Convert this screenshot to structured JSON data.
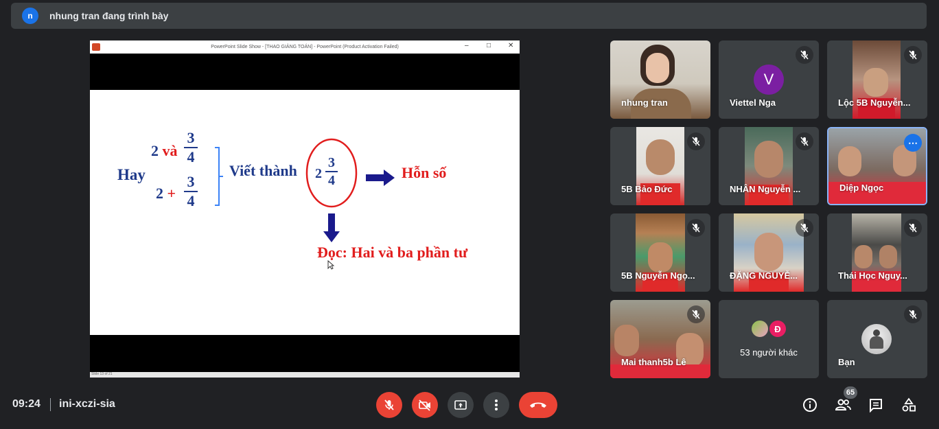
{
  "banner": {
    "avatar_letter": "n",
    "text": "nhung tran đang trình bày"
  },
  "slide_window": {
    "title": "PowerPoint Slide Show - [THAO GIẢNG TOÁN] - PowerPoint (Product Activation Failed)",
    "status": "Slide 13 of 21",
    "slide": {
      "hay": "Hay",
      "two_and": "2 và",
      "two": "2",
      "plus": "+",
      "three": "3",
      "four": "4",
      "viet_thanh": "Viết thành",
      "hon_so": "Hỗn số",
      "doc": "Đọc: Hai  và  ba phần tư"
    }
  },
  "participants": [
    {
      "name": "nhung tran"
    },
    {
      "name": "Viettel Nga",
      "avatar_letter": "V"
    },
    {
      "name": "Lộc 5B Nguyễn..."
    },
    {
      "name": "5B Bảo Đức"
    },
    {
      "name": "NHÂN Nguyễn ..."
    },
    {
      "name": "Diệp Ngọc"
    },
    {
      "name": "5B Nguyễn Ngọ..."
    },
    {
      "name": "ĐẶNG NGUYỄ..."
    },
    {
      "name": "Thái Học Nguy..."
    },
    {
      "name": "Mai thanh5b Lê"
    },
    {
      "name": "53 người khác",
      "avatar_letter": "Đ"
    },
    {
      "name": "Bạn"
    }
  ],
  "bottom_bar": {
    "time": "09:24",
    "meeting_code": "ini-xczi-sia",
    "people_count": "65"
  },
  "colors": {
    "accent_red": "#ea4335",
    "tile_bg": "#3c4043",
    "bg": "#202124",
    "slide_blue": "#1f3a8a",
    "slide_red": "#e11d1d"
  }
}
